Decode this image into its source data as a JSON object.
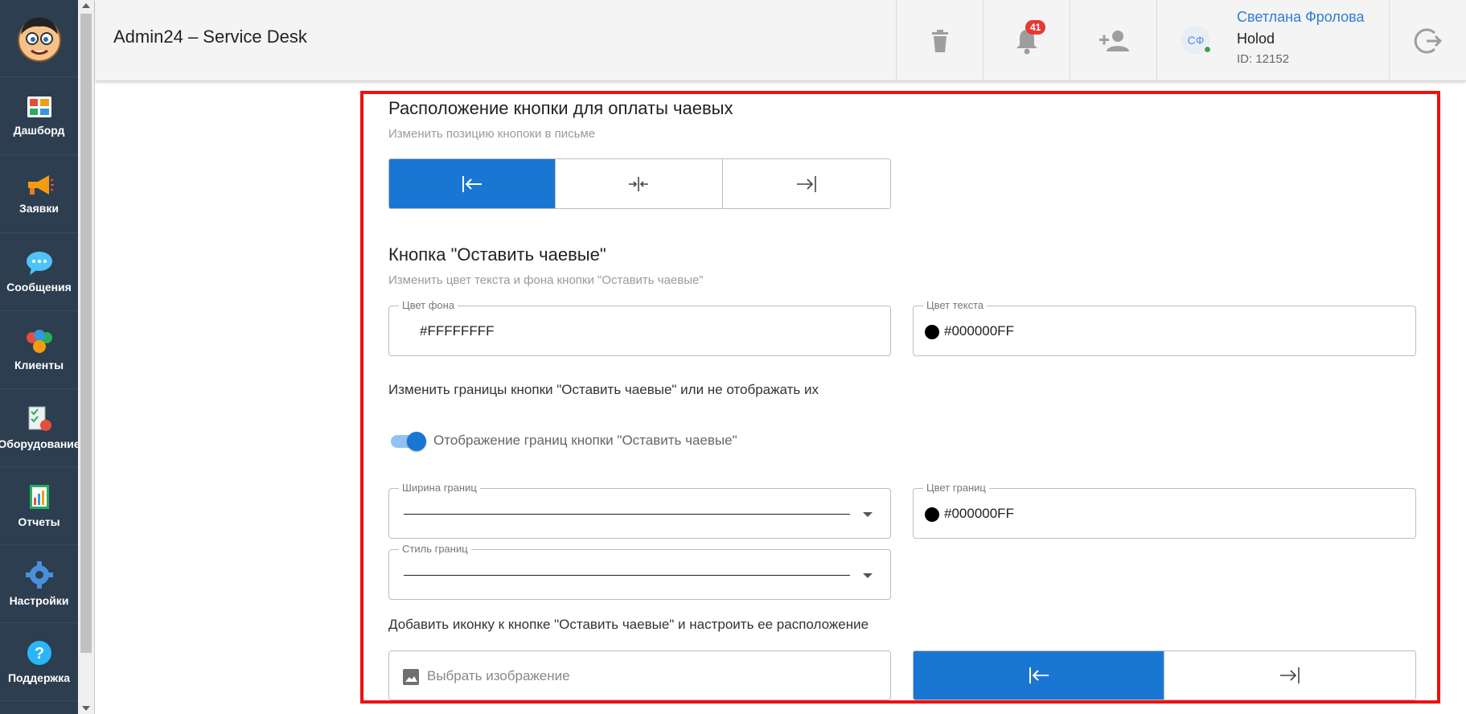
{
  "app": {
    "title": "Admin24 – Service Desk"
  },
  "sidebar": {
    "items": [
      {
        "label": "Дашборд",
        "icon": "dashboard-icon"
      },
      {
        "label": "Заявки",
        "icon": "megaphone-icon"
      },
      {
        "label": "Сообщения",
        "icon": "chat-icon"
      },
      {
        "label": "Клиенты",
        "icon": "clients-icon"
      },
      {
        "label": "Оборудование",
        "icon": "equipment-icon"
      },
      {
        "label": "Отчеты",
        "icon": "reports-icon"
      },
      {
        "label": "Настройки",
        "icon": "gear-icon"
      },
      {
        "label": "Поддержка",
        "icon": "help-icon"
      }
    ]
  },
  "header": {
    "notifications_count": "41",
    "user": {
      "initials": "СФ",
      "name": "Светлана Фролова",
      "company": "Holod",
      "id": "ID: 12152"
    }
  },
  "tip_position": {
    "title": "Расположение кнопки для оплаты чаевых",
    "subtitle": "Изменить позицию кнопоки в письме",
    "options": [
      "align-left",
      "align-center",
      "align-right"
    ],
    "selected": "align-left"
  },
  "tip_button": {
    "title": "Кнопка \"Оставить чаевые\"",
    "subtitle": "Изменить цвет текста и фона кнопки \"Оставить чаевые\"",
    "bg_color_label": "Цвет фона",
    "bg_color_value": "#FFFFFFFF",
    "text_color_label": "Цвет текста",
    "text_color_value": "#000000FF"
  },
  "borders": {
    "heading": "Изменить границы кнопки \"Оставить чаевые\" или не отображать их",
    "toggle_label": "Отображение границ кнопки \"Оставить чаевые\"",
    "toggle_on": true,
    "width_label": "Ширина границ",
    "color_label": "Цвет границ",
    "color_value": "#000000FF",
    "style_label": "Стиль границ"
  },
  "icon_section": {
    "heading": "Добавить иконку к кнопке \"Оставить чаевые\" и настроить ее расположение",
    "picker_placeholder": "Выбрать изображение",
    "options": [
      "icon-left",
      "icon-right"
    ],
    "selected": "icon-left"
  },
  "colors": {
    "accent": "#1976d2",
    "sidebar": "#2d3e50",
    "highlight": "#ee1111"
  }
}
